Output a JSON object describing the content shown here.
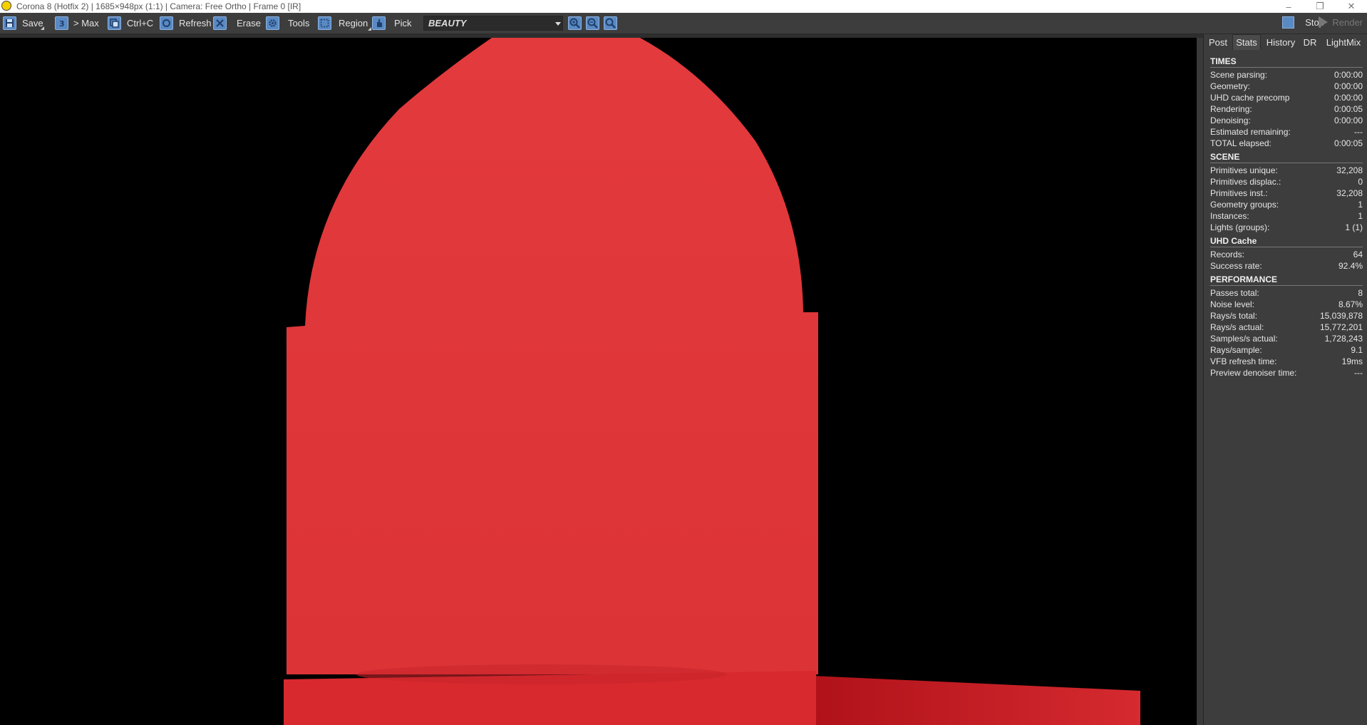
{
  "window": {
    "title": "Corona 8 (Hotfix 2) | 1685×948px (1:1) | Camera: Free Ortho | Frame 0 [IR]",
    "minimize": "–",
    "restore": "❐",
    "close": "✕"
  },
  "toolbar": {
    "save": "Save",
    "max": "> Max",
    "copy": "Ctrl+C",
    "refresh": "Refresh",
    "erase": "Erase",
    "tools": "Tools",
    "region": "Region",
    "pick": "Pick",
    "render_pass": "BEAUTY",
    "stop": "Stop",
    "render": "Render"
  },
  "render_image": {
    "object_color": "#e0383b",
    "background": "#000000"
  },
  "panel": {
    "tabs": [
      "Post",
      "Stats",
      "History",
      "DR",
      "LightMix"
    ],
    "active_tab": "Stats",
    "sections": [
      {
        "title": "TIMES",
        "rows": [
          {
            "label": "Scene parsing:",
            "value": "0:00:00"
          },
          {
            "label": "Geometry:",
            "value": "0:00:00"
          },
          {
            "label": "UHD cache precomp",
            "value": "0:00:00"
          },
          {
            "label": "Rendering:",
            "value": "0:00:05"
          },
          {
            "label": "Denoising:",
            "value": "0:00:00"
          },
          {
            "label": "Estimated remaining:",
            "value": "---"
          },
          {
            "label": "TOTAL elapsed:",
            "value": "0:00:05"
          }
        ]
      },
      {
        "title": "SCENE",
        "rows": [
          {
            "label": "Primitives unique:",
            "value": "32,208"
          },
          {
            "label": "Primitives displac.:",
            "value": "0"
          },
          {
            "label": "Primitives inst.:",
            "value": "32,208"
          },
          {
            "label": "Geometry groups:",
            "value": "1"
          },
          {
            "label": "Instances:",
            "value": "1"
          },
          {
            "label": "Lights (groups):",
            "value": "1 (1)"
          }
        ]
      },
      {
        "title": "UHD Cache",
        "rows": [
          {
            "label": "Records:",
            "value": "64"
          },
          {
            "label": "Success rate:",
            "value": "92.4%"
          }
        ]
      },
      {
        "title": "PERFORMANCE",
        "rows": [
          {
            "label": "Passes total:",
            "value": "8"
          },
          {
            "label": "Noise level:",
            "value": "8.67%"
          },
          {
            "label": "Rays/s total:",
            "value": "15,039,878"
          },
          {
            "label": "Rays/s actual:",
            "value": "15,772,201"
          },
          {
            "label": "Samples/s actual:",
            "value": "1,728,243"
          },
          {
            "label": "Rays/sample:",
            "value": "9.1"
          },
          {
            "label": "VFB refresh time:",
            "value": "19ms"
          },
          {
            "label": "Preview denoiser time:",
            "value": "---"
          }
        ]
      }
    ]
  }
}
